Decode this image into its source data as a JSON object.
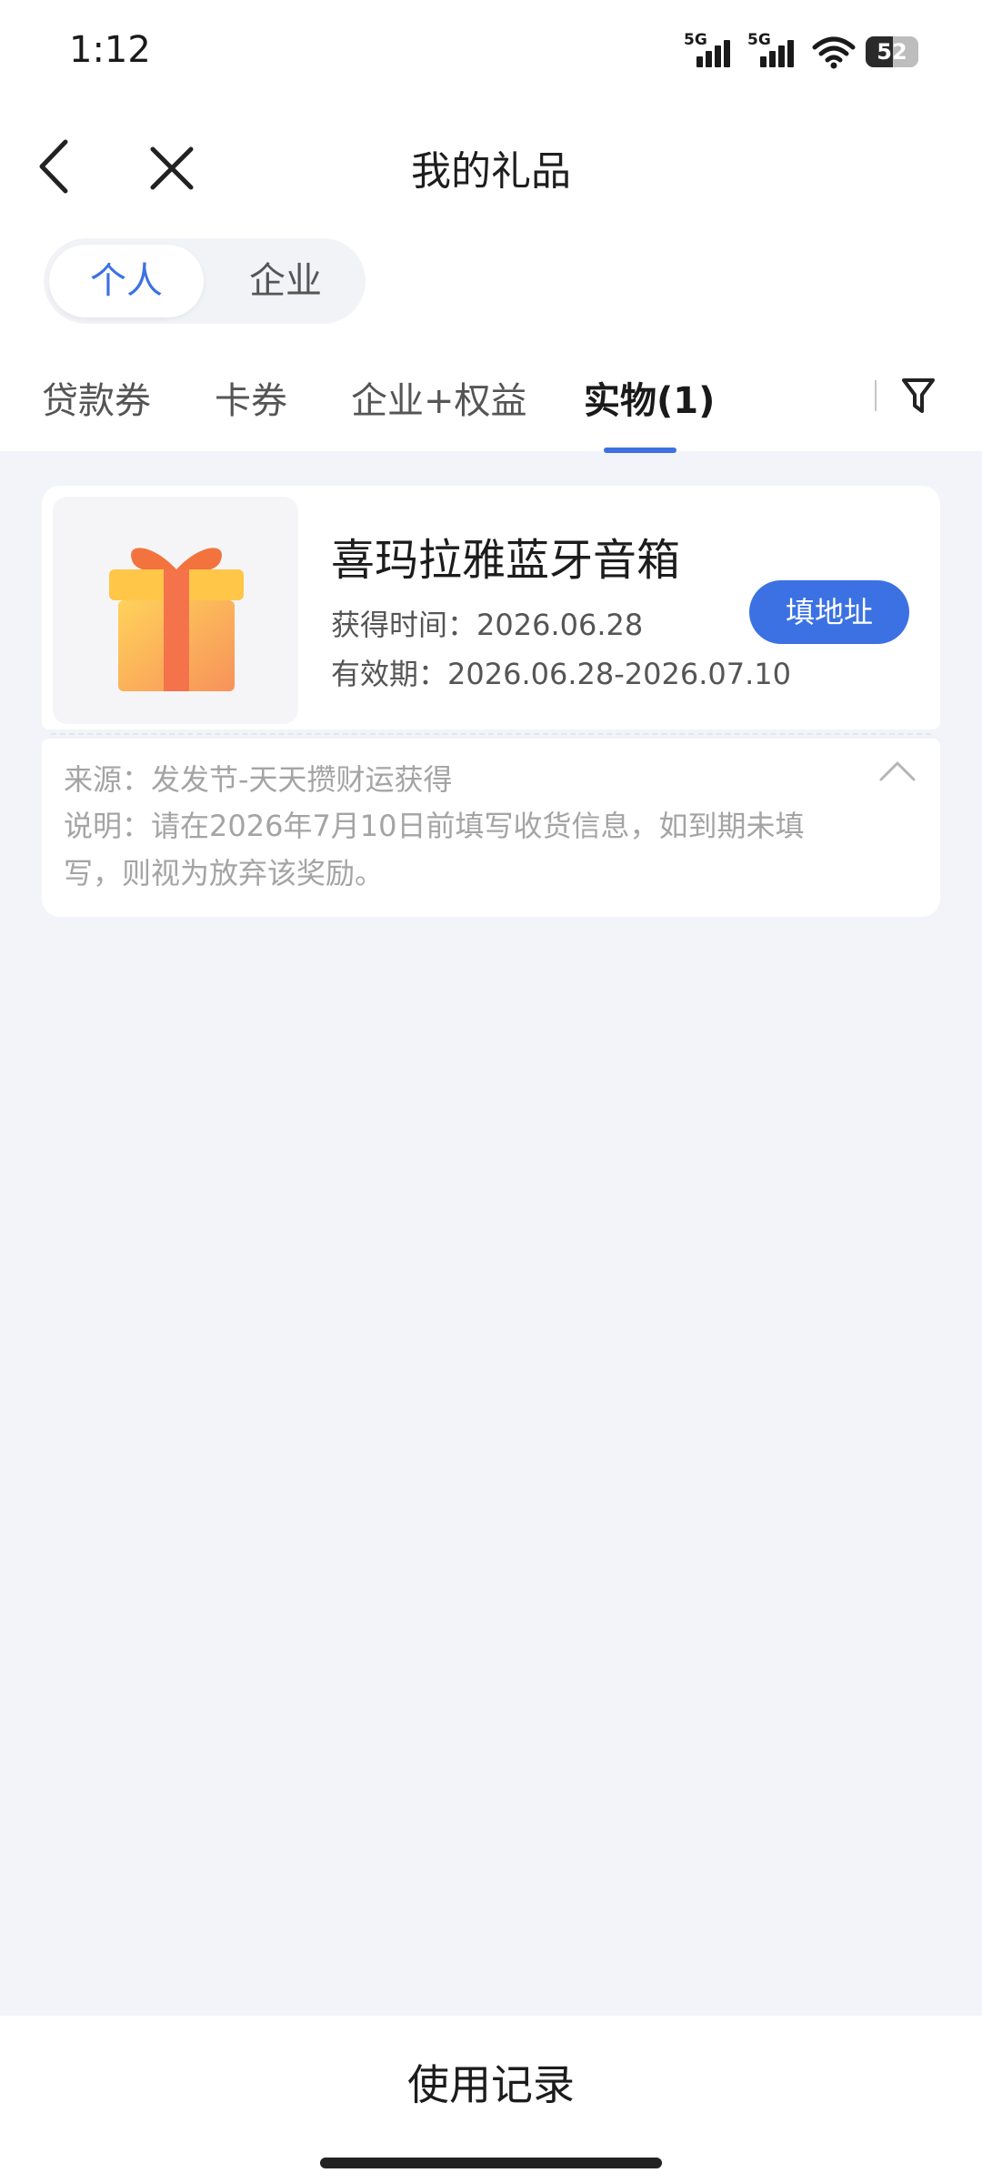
{
  "status_bar": {
    "time": "1:12",
    "network_1": "5G",
    "network_2": "5G",
    "battery": "52",
    "battery_level": 0.52
  },
  "nav": {
    "title": "我的礼品"
  },
  "segment": {
    "personal": "个人",
    "enterprise": "企业",
    "selected": "个人"
  },
  "tabs": [
    {
      "label": "贷款券"
    },
    {
      "label": "卡券"
    },
    {
      "label": "企业+权益"
    },
    {
      "label": "实物(1)"
    }
  ],
  "active_tab": "实物(1)",
  "gift": {
    "name": "喜玛拉雅蓝牙音箱",
    "obtained": "获得时间：2026.06.28",
    "validity": "有效期：2026.06.28-2026.07.10",
    "button": "填地址",
    "source": "来源：发发节-天天攒财运获得",
    "description": "说明：请在2026年7月10日前填写收货信息，如到期未填写，则视为放弃该奖励。"
  },
  "bottom": {
    "label": "使用记录"
  },
  "colors": {
    "accent": "#3b71e3",
    "background": "#f2f4f9"
  }
}
